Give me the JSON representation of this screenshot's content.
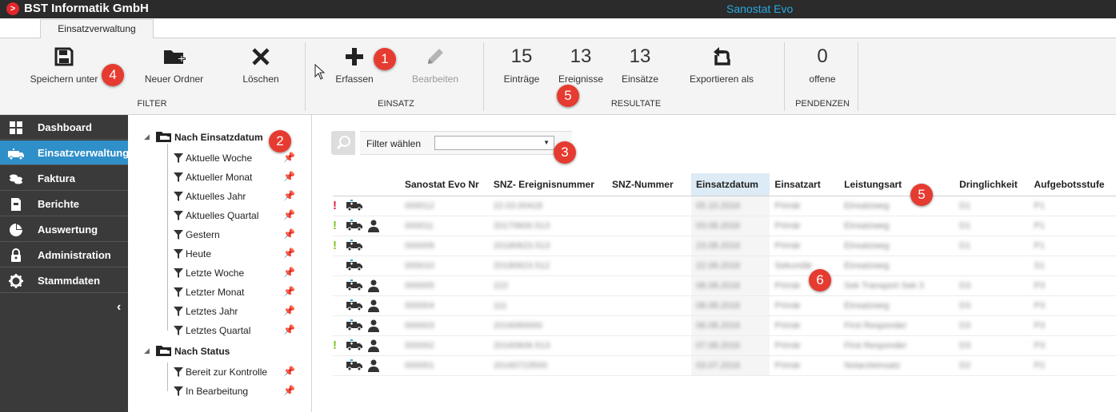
{
  "titlebar": {
    "company": "BST Informatik GmbH",
    "app": "Sanostat Evo"
  },
  "tabs": [
    {
      "label": "Einsatzverwaltung"
    }
  ],
  "ribbon": {
    "filter": {
      "group_label": "FILTER",
      "save_label": "Speichern unter",
      "new_folder_label": "Neuer Ordner",
      "delete_label": "Löschen"
    },
    "einsatz": {
      "group_label": "EINSATZ",
      "create_label": "Erfassen",
      "edit_label": "Bearbeiten"
    },
    "resultate": {
      "group_label": "RESULTATE",
      "entries_count": "15",
      "entries_label": "Einträge",
      "events_count": "13",
      "events_label": "Ereignisse",
      "operations_count": "13",
      "operations_label": "Einsätze",
      "export_label": "Exportieren als"
    },
    "pendenzen": {
      "group_label": "PENDENZEN",
      "open_count": "0",
      "open_label": "offene"
    }
  },
  "callouts": [
    "1",
    "2",
    "3",
    "4",
    "5",
    "5",
    "6"
  ],
  "nav": {
    "items": [
      {
        "label": "Dashboard",
        "icon": "grid-icon"
      },
      {
        "label": "Einsatzverwaltung",
        "icon": "ambulance-icon",
        "active": true
      },
      {
        "label": "Faktura",
        "icon": "coins-icon"
      },
      {
        "label": "Berichte",
        "icon": "report-icon"
      },
      {
        "label": "Auswertung",
        "icon": "pie-chart-icon"
      },
      {
        "label": "Administration",
        "icon": "lock-icon"
      },
      {
        "label": "Stammdaten",
        "icon": "gear-icon"
      }
    ],
    "collapse_glyph": "‹"
  },
  "tree": {
    "groups": [
      {
        "label": "Nach Einsatzdatum",
        "items": [
          "Aktuelle Woche",
          "Aktueller Monat",
          "Aktuelles Jahr",
          "Aktuelles Quartal",
          "Gestern",
          "Heute",
          "Letzte Woche",
          "Letzter Monat",
          "Letztes Jahr",
          "Letztes Quartal"
        ]
      },
      {
        "label": "Nach Status",
        "items": [
          "Bereit zur Kontrolle",
          "In Bearbeitung"
        ]
      }
    ]
  },
  "filter": {
    "label": "Filter wählen",
    "selected": ""
  },
  "grid": {
    "columns": [
      "Sanostat Evo Nr",
      "SNZ- Ereignisnummer",
      "SNZ-Nummer",
      "Einsatzdatum",
      "Einsatzart",
      "Leistungsart",
      "Dringlichkeit",
      "Aufgebotsstufe"
    ],
    "sorted_column": 3,
    "rows": [
      {
        "flag": "!",
        "flag_color": "#e0203a",
        "person": false,
        "cells": [
          "000012",
          "22.03.00418",
          "",
          "05.10.2016",
          "Primär",
          "Einsatzweg",
          "D1",
          "P1"
        ]
      },
      {
        "flag": "!",
        "flag_color": "#7ec41f",
        "person": true,
        "cells": [
          "000011",
          "20170600.513",
          "",
          "03.08.2016",
          "Primär",
          "Einsatzweg",
          "D1",
          "P1"
        ]
      },
      {
        "flag": "!",
        "flag_color": "#7ec41f",
        "person": false,
        "cells": [
          "000009",
          "20180623.513",
          "",
          "23.08.2016",
          "Primär",
          "Einsatzweg",
          "D1",
          "P1"
        ]
      },
      {
        "flag": "",
        "flag_color": "",
        "person": false,
        "cells": [
          "000010",
          "20180623.512",
          "",
          "22.08.2016",
          "Sekundär",
          "Einsatzweg",
          "",
          "S1"
        ]
      },
      {
        "flag": "",
        "flag_color": "",
        "person": true,
        "cells": [
          "000005",
          "222",
          "",
          "08.08.2016",
          "Primär",
          "Sek Transport Sek 3",
          "D3",
          "P3"
        ]
      },
      {
        "flag": "",
        "flag_color": "",
        "person": true,
        "cells": [
          "000004",
          "111",
          "",
          "08.08.2016",
          "Primär",
          "Einsatzweg",
          "D3",
          "P3"
        ]
      },
      {
        "flag": "",
        "flag_color": "",
        "person": true,
        "cells": [
          "000003",
          "2016060000",
          "",
          "06.08.2016",
          "Primär",
          "First Responder",
          "D3",
          "P3"
        ]
      },
      {
        "flag": "!",
        "flag_color": "#7ec41f",
        "person": true,
        "cells": [
          "000002",
          "20160606.513",
          "",
          "07.08.2016",
          "Primär",
          "First Responder",
          "D3",
          "P3"
        ]
      },
      {
        "flag": "",
        "flag_color": "",
        "person": true,
        "cells": [
          "000001",
          "20160723500",
          "",
          "03.07.2016",
          "Primär",
          "Notarzteinsatz",
          "D2",
          "P2"
        ]
      }
    ]
  }
}
